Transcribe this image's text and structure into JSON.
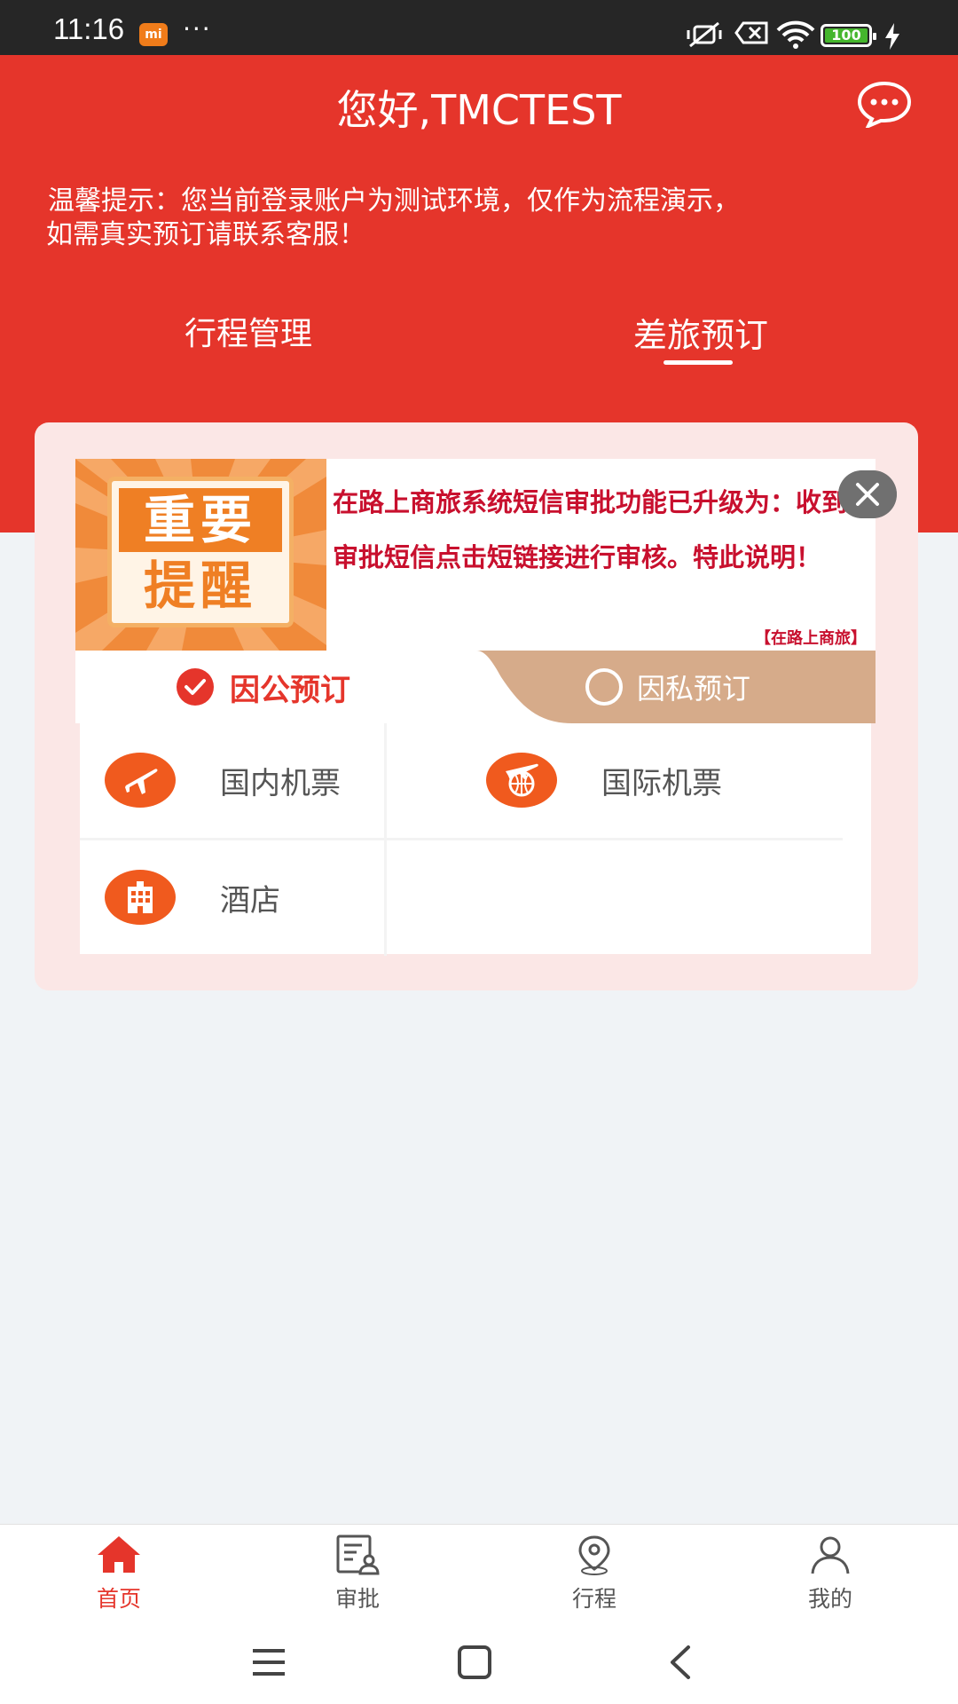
{
  "status_bar": {
    "time": "11:16",
    "brand_badge": "mi",
    "more": "···",
    "battery": "100"
  },
  "header": {
    "greeting": "您好,TMCTEST",
    "notice_line1": "温馨提示：您当前登录账户为测试环境，仅作为流程演示，",
    "notice_line2": "如需真实预订请联系客服！",
    "tabs": [
      {
        "label": "行程管理",
        "active": false
      },
      {
        "label": "差旅预订",
        "active": true
      }
    ]
  },
  "banner": {
    "badge_top": "重要",
    "badge_bottom": "提醒",
    "message": "在路上商旅系统短信审批功能已升级为：收到审批短信点击短链接进行审核。特此说明！",
    "source": "【在路上商旅】"
  },
  "booking_type": {
    "corporate": "因公预订",
    "private": "因私预订",
    "selected": "corporate"
  },
  "services": [
    {
      "label": "国内机票",
      "icon": "domestic-flight-icon"
    },
    {
      "label": "国际机票",
      "icon": "international-flight-icon"
    },
    {
      "label": "酒店",
      "icon": "hotel-icon"
    }
  ],
  "bottom_nav": [
    {
      "label": "首页",
      "icon": "home-icon",
      "active": true
    },
    {
      "label": "审批",
      "icon": "approval-icon",
      "active": false
    },
    {
      "label": "行程",
      "icon": "location-icon",
      "active": false
    },
    {
      "label": "我的",
      "icon": "user-icon",
      "active": false
    }
  ],
  "colors": {
    "primary_red": "#e5352b",
    "accent_orange": "#f05a1e",
    "private_tab_tan": "#d6ab8a",
    "banner_text_red": "#c8102e"
  }
}
